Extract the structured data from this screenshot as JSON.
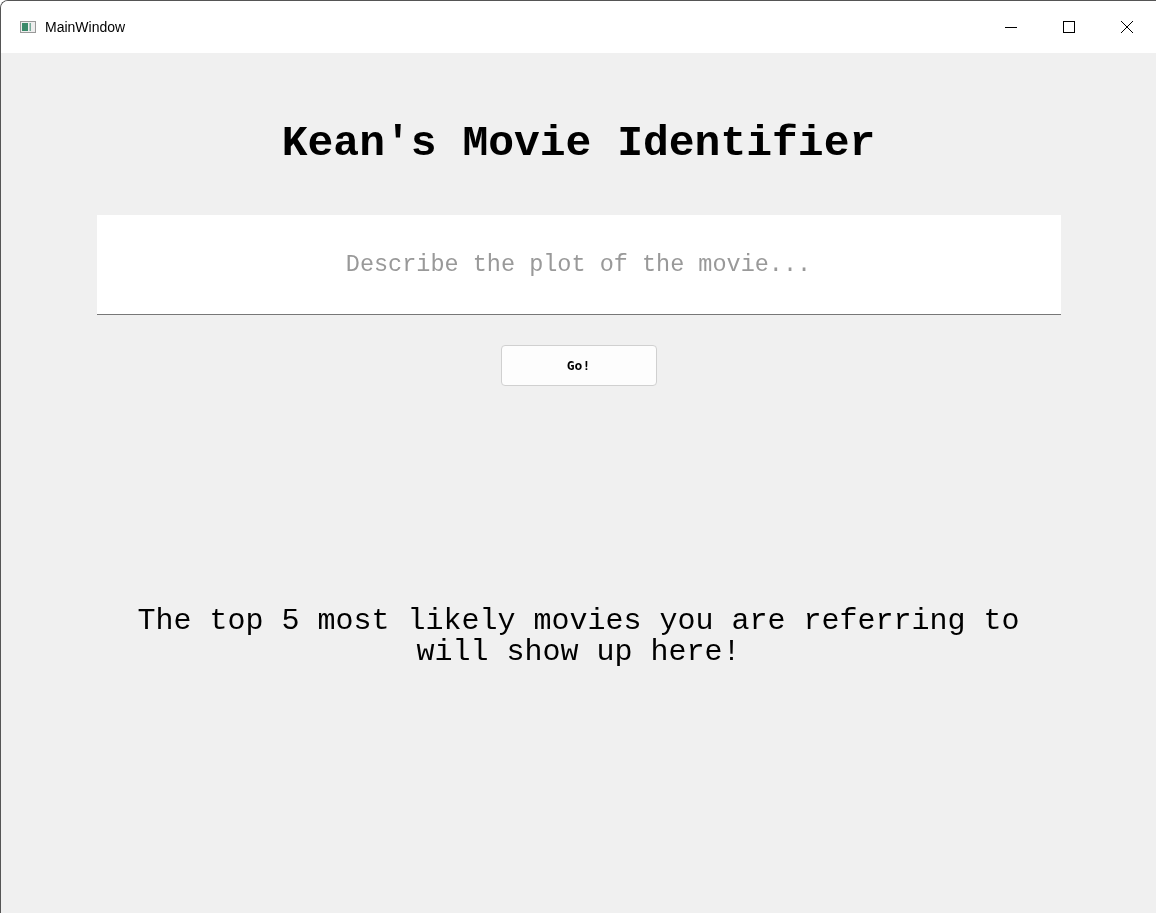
{
  "window": {
    "title": "MainWindow"
  },
  "heading": "Kean's Movie Identifier",
  "plot_field": {
    "placeholder": "Describe the plot of the movie..."
  },
  "go_button": "Go!",
  "results_message": "The top 5 most likely movies you are referring to will show up here!"
}
